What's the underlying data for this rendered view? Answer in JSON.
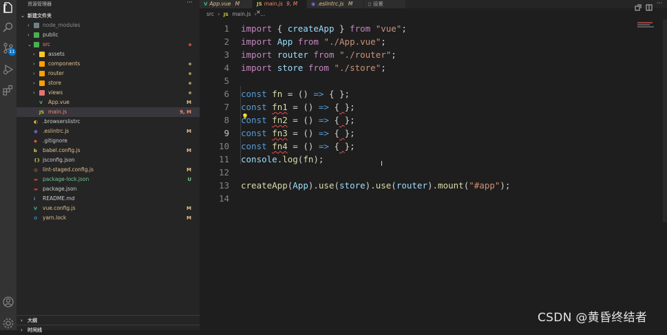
{
  "colors": {
    "keyword": "#c586c0",
    "storage": "#569cd6",
    "string": "#ce9178",
    "variable": "#9cdcfe",
    "constant": "#4fc1ff",
    "function": "#dcdcaa",
    "modified": "#e2c08d",
    "untracked": "#73c991",
    "error": "#f48771"
  },
  "activity_bar": {
    "icons": [
      "explorer-icon",
      "search-icon",
      "source-control-icon",
      "run-debug-icon",
      "extensions-icon",
      "account-icon",
      "settings-icon"
    ],
    "scm_badge": "11"
  },
  "sidebar": {
    "title": "资源管理器",
    "more": "···",
    "root_label": "新建文件夹",
    "items": [
      {
        "name": "node_modules",
        "state": "ignored",
        "status": ""
      },
      {
        "name": "public",
        "state": "normal",
        "status": ""
      },
      {
        "name": "src",
        "state": "error",
        "status": ""
      },
      {
        "name": "assets",
        "state": "normal",
        "status": ""
      },
      {
        "name": "components",
        "state": "modified",
        "status": ""
      },
      {
        "name": "router",
        "state": "modified",
        "status": ""
      },
      {
        "name": "store",
        "state": "modified",
        "status": ""
      },
      {
        "name": "views",
        "state": "modified",
        "status": ""
      },
      {
        "name": "App.vue",
        "state": "modified",
        "status": "M"
      },
      {
        "name": "main.js",
        "state": "error",
        "status": "9, M"
      },
      {
        "name": ".browserslistrc",
        "state": "normal",
        "status": ""
      },
      {
        "name": ".eslintrc.js",
        "state": "modified",
        "status": "M"
      },
      {
        "name": ".gitignore",
        "state": "normal",
        "status": ""
      },
      {
        "name": "babel.config.js",
        "state": "modified",
        "status": "M"
      },
      {
        "name": "jsconfig.json",
        "state": "normal",
        "status": ""
      },
      {
        "name": "lint-staged.config.js",
        "state": "modified",
        "status": "M"
      },
      {
        "name": "package-lock.json",
        "state": "untracked",
        "status": "U"
      },
      {
        "name": "package.json",
        "state": "normal",
        "status": ""
      },
      {
        "name": "README.md",
        "state": "normal",
        "status": ""
      },
      {
        "name": "vue.config.js",
        "state": "modified",
        "status": "M"
      },
      {
        "name": "yarn.lock",
        "state": "modified",
        "status": "M"
      }
    ],
    "outline_label": "大纲",
    "timeline_label": "时间线"
  },
  "tabs": [
    {
      "label": "App.vue",
      "status": "M",
      "active": false
    },
    {
      "label": "main.js",
      "status": "9, M",
      "active": true
    },
    {
      "label": ".eslintrc.js",
      "status": "M",
      "active": false
    },
    {
      "label": "设置",
      "status": "",
      "active": false
    }
  ],
  "tab_close": "×",
  "breadcrumb": {
    "folder": "src",
    "file": "main.js",
    "symbol": "..."
  },
  "editor": {
    "line_numbers": [
      "1",
      "2",
      "3",
      "4",
      "5",
      "6",
      "7",
      "8",
      "9",
      "10",
      "11",
      "12",
      "13",
      "14"
    ],
    "current_line": "9",
    "lines": [
      [
        [
          "import",
          "k"
        ],
        [
          " { ",
          ""
        ],
        [
          "createApp",
          "v"
        ],
        [
          " } ",
          ""
        ],
        [
          "from",
          "k"
        ],
        [
          " ",
          ""
        ],
        [
          "\"vue\"",
          "s"
        ],
        [
          ";",
          ""
        ]
      ],
      [
        [
          "import",
          "k"
        ],
        [
          " ",
          ""
        ],
        [
          "App",
          "v"
        ],
        [
          " ",
          ""
        ],
        [
          "from",
          "k"
        ],
        [
          " ",
          ""
        ],
        [
          "\"./App.vue\"",
          "s"
        ],
        [
          ";",
          ""
        ]
      ],
      [
        [
          "import",
          "k"
        ],
        [
          " ",
          ""
        ],
        [
          "router",
          "v"
        ],
        [
          " ",
          ""
        ],
        [
          "from",
          "k"
        ],
        [
          " ",
          ""
        ],
        [
          "\"./router\"",
          "s"
        ],
        [
          ";",
          ""
        ]
      ],
      [
        [
          "import",
          "k"
        ],
        [
          " ",
          ""
        ],
        [
          "store",
          "v"
        ],
        [
          " ",
          ""
        ],
        [
          "from",
          "k"
        ],
        [
          " ",
          ""
        ],
        [
          "\"./store\"",
          "s"
        ],
        [
          ";",
          ""
        ]
      ],
      [],
      [
        [
          "const",
          "kb"
        ],
        [
          " ",
          ""
        ],
        [
          "fn",
          "f"
        ],
        [
          " = () ",
          ""
        ],
        [
          "=>",
          "kb"
        ],
        [
          " { };",
          ""
        ]
      ],
      [
        [
          "const",
          "kb"
        ],
        [
          " ",
          ""
        ],
        [
          "fn1",
          "f wavy"
        ],
        [
          " = () ",
          ""
        ],
        [
          "=>",
          "kb"
        ],
        [
          " {",
          ""
        ],
        [
          " ",
          "wavy"
        ],
        [
          "};",
          ""
        ]
      ],
      [
        [
          "const",
          "kb"
        ],
        [
          " ",
          ""
        ],
        [
          "fn2",
          "f wavy"
        ],
        [
          " = () ",
          ""
        ],
        [
          "=>",
          "kb"
        ],
        [
          " {",
          ""
        ],
        [
          " ",
          "wavy"
        ],
        [
          "};",
          ""
        ]
      ],
      [
        [
          "const",
          "kb"
        ],
        [
          " ",
          ""
        ],
        [
          "fn3",
          "f wavy"
        ],
        [
          " = () ",
          ""
        ],
        [
          "=>",
          "kb"
        ],
        [
          " {",
          ""
        ],
        [
          " ",
          "wavy"
        ],
        [
          "};",
          ""
        ]
      ],
      [
        [
          "const",
          "kb"
        ],
        [
          " ",
          ""
        ],
        [
          "fn4",
          "f wavy"
        ],
        [
          " = () ",
          ""
        ],
        [
          "=>",
          "kb"
        ],
        [
          " {",
          ""
        ],
        [
          " ",
          "wavy"
        ],
        [
          "};",
          ""
        ]
      ],
      [
        [
          "console",
          "v"
        ],
        [
          ".",
          ""
        ],
        [
          "log",
          "f"
        ],
        [
          "(",
          ""
        ],
        [
          "fn",
          "f"
        ],
        [
          ");",
          ""
        ]
      ],
      [],
      [
        [
          "createApp",
          "f"
        ],
        [
          "(",
          ""
        ],
        [
          "App",
          "v"
        ],
        [
          ").",
          ""
        ],
        [
          "use",
          "f"
        ],
        [
          "(",
          ""
        ],
        [
          "store",
          "v"
        ],
        [
          ").",
          ""
        ],
        [
          "use",
          "f"
        ],
        [
          "(",
          ""
        ],
        [
          "router",
          "v"
        ],
        [
          ").",
          ""
        ],
        [
          "mount",
          "f"
        ],
        [
          "(",
          ""
        ],
        [
          "\"#app\"",
          "s"
        ],
        [
          ");",
          ""
        ]
      ],
      []
    ]
  },
  "watermark": "CSDN @黄昏终结者"
}
